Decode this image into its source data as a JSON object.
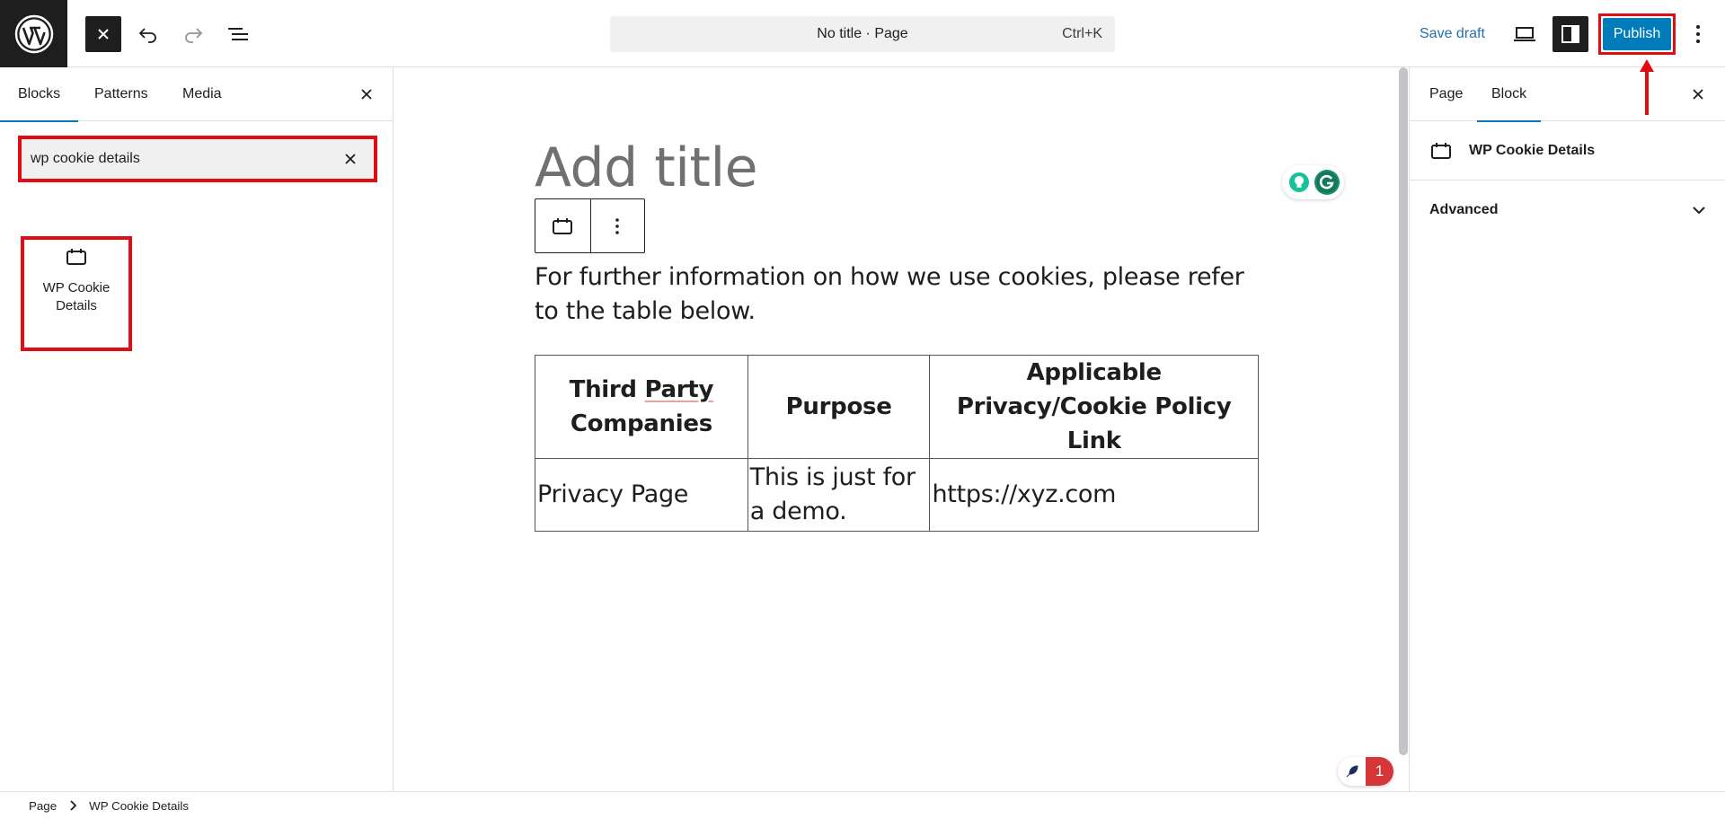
{
  "topbar": {
    "logo": "wordpress-logo",
    "command_center": {
      "title": "No title · Page",
      "shortcut": "Ctrl+K"
    },
    "save_draft": "Save draft",
    "publish": "Publish"
  },
  "inserter": {
    "tabs": [
      {
        "label": "Blocks",
        "active": true
      },
      {
        "label": "Patterns",
        "active": false
      },
      {
        "label": "Media",
        "active": false
      }
    ],
    "search": {
      "value": "wp cookie details",
      "placeholder": "Search"
    },
    "results": [
      {
        "label": "WP Cookie Details",
        "icon": "calendar-block-icon"
      }
    ]
  },
  "editor": {
    "title_placeholder": "Add title",
    "paragraph": "For further information on how we use cookies, please refer to the table below.",
    "table": {
      "headers": [
        "Third Party Companies",
        "Purpose",
        "Applicable Privacy/Cookie Policy Link"
      ],
      "rows": [
        [
          "Privacy Page",
          "This is just for a demo.",
          "https://xyz.com"
        ]
      ]
    },
    "notification_count": "1"
  },
  "sidebar": {
    "tabs": [
      {
        "label": "Page",
        "active": false
      },
      {
        "label": "Block",
        "active": true
      }
    ],
    "block_card_title": "WP Cookie Details",
    "panels": [
      {
        "label": "Advanced",
        "expanded": false
      }
    ]
  },
  "breadcrumb": [
    "Page",
    "WP Cookie Details"
  ],
  "colors": {
    "accent": "#007cba",
    "annotation_red": "#e00d14",
    "dark": "#1e1e1e"
  }
}
